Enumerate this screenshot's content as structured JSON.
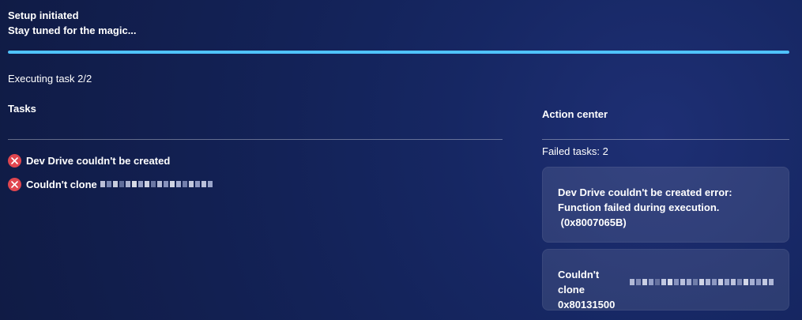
{
  "header": {
    "title": "Setup initiated",
    "subtitle": "Stay tuned for the magic..."
  },
  "progress": {
    "value": 1.0,
    "color": "#4fc3ff"
  },
  "status": {
    "text": "Executing task 2/2"
  },
  "tasks": {
    "title": "Tasks",
    "items": [
      {
        "label": "Dev Drive couldn't be created",
        "status_icon": "error-icon"
      },
      {
        "label": "Couldn't clone",
        "status_icon": "error-icon"
      }
    ]
  },
  "action_center": {
    "title": "Action center",
    "failed_label": "Failed tasks: 2",
    "cards": [
      {
        "line1": "Dev Drive couldn't be created error:",
        "line2": "Function failed during execution.",
        "line3": " (0x8007065B)"
      },
      {
        "line1": "Couldn't clone",
        "line2": "0x80131500"
      }
    ]
  },
  "colors": {
    "error_red": "#e0464f",
    "text": "#ffffff"
  },
  "icons": {
    "error": "close-icon"
  }
}
